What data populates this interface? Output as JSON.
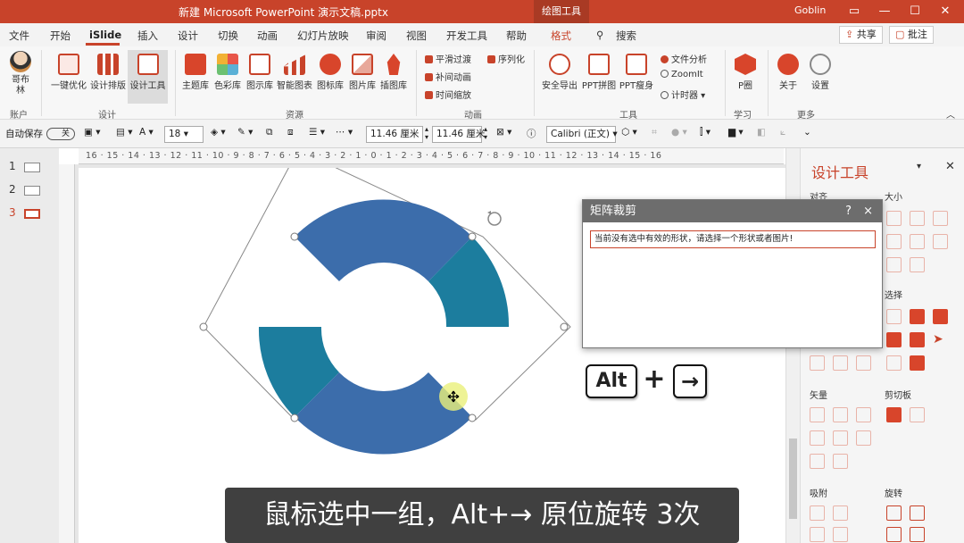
{
  "titlebar": {
    "doc_title": "新建 Microsoft PowerPoint 演示文稿.pptx",
    "context_tab": "绘图工具",
    "user": "Goblin"
  },
  "menu": {
    "tabs": [
      "文件",
      "开始",
      "iSlide",
      "插入",
      "设计",
      "切换",
      "动画",
      "幻灯片放映",
      "审阅",
      "视图",
      "开发工具",
      "帮助",
      "格式"
    ],
    "search": "搜索",
    "share": "共享",
    "comment": "批注"
  },
  "ribbon": {
    "account": {
      "name": "哥布林",
      "group": "账户"
    },
    "design_items": [
      "一键优化",
      "设计排版",
      "设计工具"
    ],
    "design_group": "设计",
    "resource_items": [
      "主题库",
      "色彩库",
      "图示库",
      "智能图表",
      "图标库",
      "图片库",
      "插图库"
    ],
    "resource_group": "资源",
    "anim_items": [
      "平滑过渡",
      "序列化",
      "补间动画",
      "时间缩放"
    ],
    "anim_group": "动画",
    "tool_items": [
      "安全导出",
      "PPT拼图",
      "PPT瘦身"
    ],
    "tool_small": [
      "文件分析",
      "ZoomIt",
      "计时器"
    ],
    "tool_group": "工具",
    "learn_item": "P圈",
    "learn_group": "学习",
    "more_items": [
      "关于",
      "设置"
    ],
    "more_group": "更多"
  },
  "format_bar": {
    "autosave": "自动保存",
    "autosave_state": "关",
    "font_size": "18",
    "width": "11.46 厘米",
    "height": "11.46 厘米",
    "font_name": "Calibri (正文)"
  },
  "slides": {
    "numbers": [
      "1",
      "2",
      "3"
    ],
    "active": 3
  },
  "ruler": {
    "ticks": "16 · 15 · 14 · 13 · 12 · 11 · 10 · 9 · 8 · 7 · 6 · 5 · 4 · 3 · 2 · 1 · 0 · 1 · 2 · 3 · 4 · 5 · 6 · 7 · 8 · 9 · 10 · 11 · 12 · 13 · 14 · 15 · 16"
  },
  "panel": {
    "title": "设计工具",
    "sections": [
      "对齐",
      "大小",
      "选择",
      "矢量",
      "剪切板",
      "吸附",
      "旋转"
    ]
  },
  "dialog": {
    "title": "矩阵裁剪",
    "help": "?",
    "close": "×",
    "message": "当前没有选中有效的形状，请选择一个形状或者图片!"
  },
  "keys": {
    "alt": "Alt",
    "plus": "+",
    "arrow": "→"
  },
  "caption": "鼠标选中一组，Alt+→ 原位旋转 3次",
  "colors": {
    "accent": "#c8432a",
    "ring_blue": "#3c6dab",
    "ring_teal": "#1c7d9e"
  }
}
